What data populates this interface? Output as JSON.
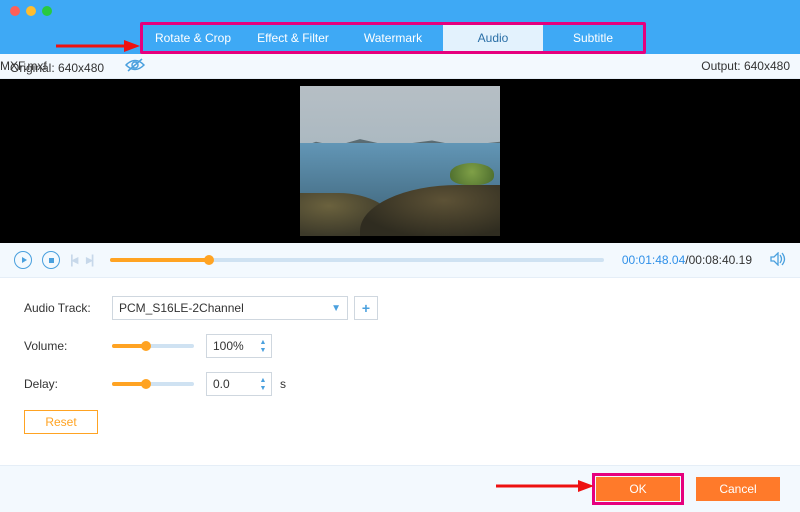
{
  "tabs": {
    "rotate": "Rotate & Crop",
    "effect": "Effect & Filter",
    "watermark": "Watermark",
    "audio": "Audio",
    "subtitle": "Subtitle"
  },
  "info": {
    "original_label": "Original: 640x480",
    "filename": "MXF.mxf",
    "output_label": "Output: 640x480"
  },
  "playback": {
    "current": "00:01:48.04",
    "total": "/00:08:40.19",
    "progress_pct": "20%"
  },
  "settings": {
    "audio_track_label": "Audio Track:",
    "audio_track_value": "PCM_S16LE-2Channel",
    "volume_label": "Volume:",
    "volume_value": "100%",
    "volume_slider_pct": "42%",
    "delay_label": "Delay:",
    "delay_value": "0.0",
    "delay_unit": "s",
    "delay_slider_pct": "42%",
    "reset_label": "Reset"
  },
  "footer": {
    "ok": "OK",
    "cancel": "Cancel"
  }
}
